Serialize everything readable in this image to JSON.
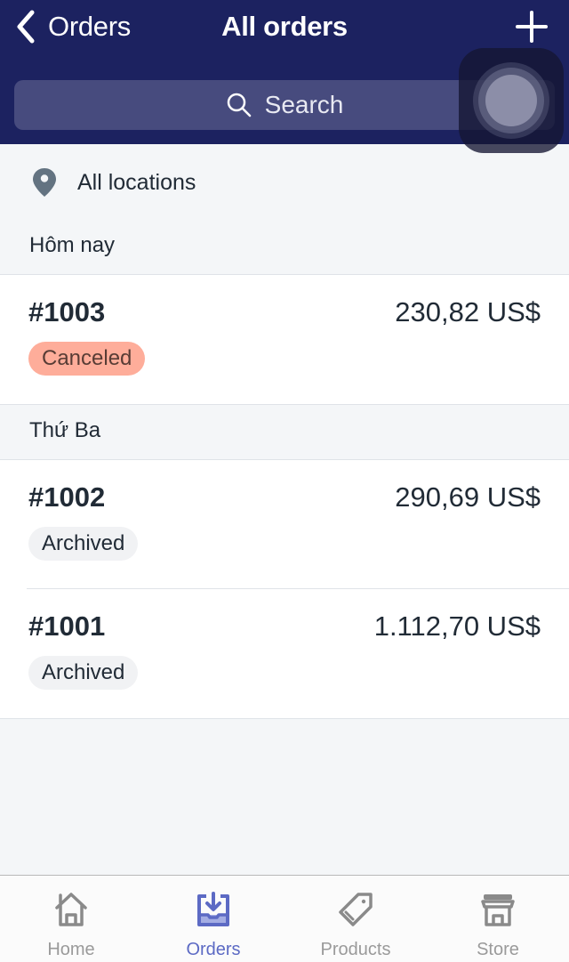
{
  "nav": {
    "back_label": "Orders",
    "title": "All orders",
    "add_icon": "plus-icon",
    "back_icon": "chevron-left-icon"
  },
  "search": {
    "placeholder": "Search",
    "icon": "search-icon"
  },
  "location_filter": {
    "label": "All locations",
    "icon": "location-pin-icon"
  },
  "sections": [
    {
      "header": "Hôm nay",
      "orders": [
        {
          "number": "#1003",
          "amount": "230,82 US$",
          "status": "Canceled"
        }
      ]
    },
    {
      "header": "Thứ Ba",
      "orders": [
        {
          "number": "#1002",
          "amount": "290,69 US$",
          "status": "Archived"
        },
        {
          "number": "#1001",
          "amount": "1.112,70 US$",
          "status": "Archived"
        }
      ]
    }
  ],
  "tabbar": {
    "items": [
      {
        "label": "Home",
        "icon": "home-icon",
        "active": false
      },
      {
        "label": "Orders",
        "icon": "orders-inbox-icon",
        "active": true
      },
      {
        "label": "Products",
        "icon": "tag-icon",
        "active": false
      },
      {
        "label": "Store",
        "icon": "store-icon",
        "active": false
      }
    ]
  },
  "colors": {
    "nav_bg": "#1c2260",
    "accent": "#5c6ac4",
    "canceled_badge": "#fead9a",
    "archived_badge": "#f1f2f4"
  }
}
